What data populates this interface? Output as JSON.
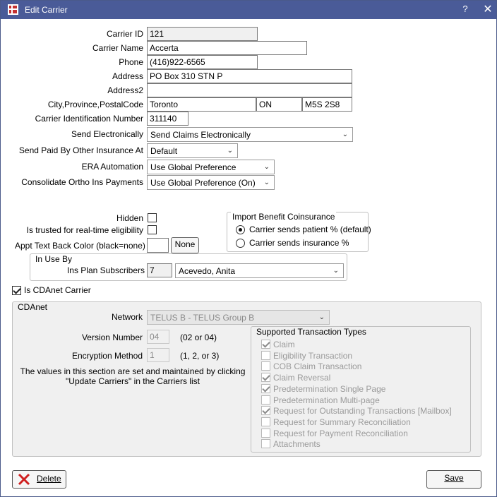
{
  "window": {
    "title": "Edit Carrier",
    "help": "?",
    "close": "✕"
  },
  "labels": {
    "carrier_id": "Carrier ID",
    "carrier_name": "Carrier Name",
    "phone": "Phone",
    "address": "Address",
    "address2": "Address2",
    "city_prov_postal": "City,Province,PostalCode",
    "carrier_identification_number": "Carrier Identification Number",
    "send_electronically": "Send Electronically",
    "send_paid_by_other": "Send Paid By Other Insurance At",
    "era_automation": "ERA Automation",
    "consolidate_ortho": "Consolidate Ortho Ins Payments",
    "hidden": "Hidden",
    "trusted": "Is trusted for real-time eligibility",
    "appt_text_color": "Appt Text Back Color (black=none)"
  },
  "values": {
    "carrier_id": "121",
    "carrier_name": "Accerta",
    "phone": "(416)922-6565",
    "address": "PO Box 310  STN P",
    "address2": "",
    "city": "Toronto",
    "province": "ON",
    "postal": "M5S 2S8",
    "carrier_identification_number": "311140",
    "send_electronically": "Send Claims Electronically",
    "send_paid_by_other": "Default",
    "era_automation": "Use Global Preference",
    "consolidate_ortho": "Use Global Preference (On)"
  },
  "none_button": "None",
  "import_benefit": {
    "title": "Import Benefit Coinsurance",
    "option1": "Carrier sends patient % (default)",
    "option2": "Carrier sends insurance %",
    "selected": 1
  },
  "in_use_by": {
    "title": "In Use By",
    "label": "Ins Plan Subscribers",
    "count": "7",
    "subscriber": "Acevedo, Anita"
  },
  "cdanet_checkbox": "Is CDAnet Carrier",
  "cdanet": {
    "title": "CDAnet",
    "network_label": "Network",
    "network_value": "TELUS B - TELUS Group B",
    "version_label": "Version Number",
    "version_value": "04",
    "version_hint": "(02 or 04)",
    "encryption_label": "Encryption Method",
    "encryption_value": "1",
    "encryption_hint": "(1, 2, or 3)",
    "note_line1": "The values in this section are set and maintained by clicking",
    "note_line2": "\"Update Carriers\" in the Carriers list"
  },
  "supported": {
    "title": "Supported Transaction Types",
    "items": [
      {
        "label": "Claim",
        "checked": true
      },
      {
        "label": "Eligibility Transaction",
        "checked": false
      },
      {
        "label": "COB Claim Transaction",
        "checked": false
      },
      {
        "label": "Claim Reversal",
        "checked": true
      },
      {
        "label": "Predetermination Single Page",
        "checked": true
      },
      {
        "label": "Predetermination Multi-page",
        "checked": false
      },
      {
        "label": "Request for Outstanding Transactions [Mailbox]",
        "checked": true
      },
      {
        "label": "Request for Summary Reconciliation",
        "checked": false
      },
      {
        "label": "Request for Payment Reconciliation",
        "checked": false
      },
      {
        "label": "Attachments",
        "checked": false
      }
    ]
  },
  "buttons": {
    "delete": "Delete",
    "save": "Save"
  },
  "colors": {
    "titlebar": "#4a5b98",
    "delete_icon": "#d02020"
  }
}
